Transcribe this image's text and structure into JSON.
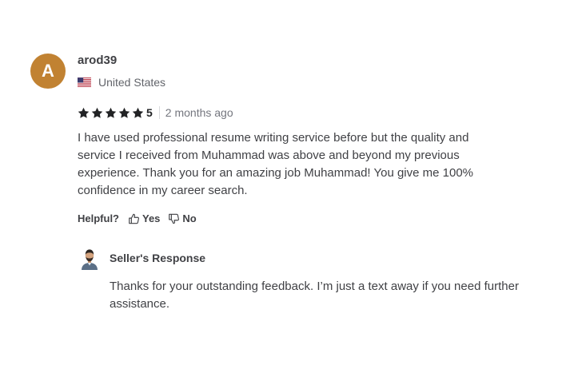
{
  "reviewer": {
    "avatar_letter": "A",
    "avatar_color": "#c18232",
    "username": "arod39",
    "country": "United States",
    "flag_icon": "us-flag-icon"
  },
  "rating": {
    "stars": 5,
    "value": "5",
    "time_ago": "2 months ago",
    "star_color": "#222325"
  },
  "review": {
    "text": "I have used professional resume writing service before but the quality and service I received from Muhammad was above and beyond my previous experience. Thank you for an amazing job Muhammad! You give me 100% confidence in my career search."
  },
  "helpful": {
    "label": "Helpful?",
    "yes_label": "Yes",
    "no_label": "No"
  },
  "seller_response": {
    "title": "Seller's Response",
    "text": "Thanks for your outstanding feedback. I’m just a text away if you need further assistance."
  }
}
